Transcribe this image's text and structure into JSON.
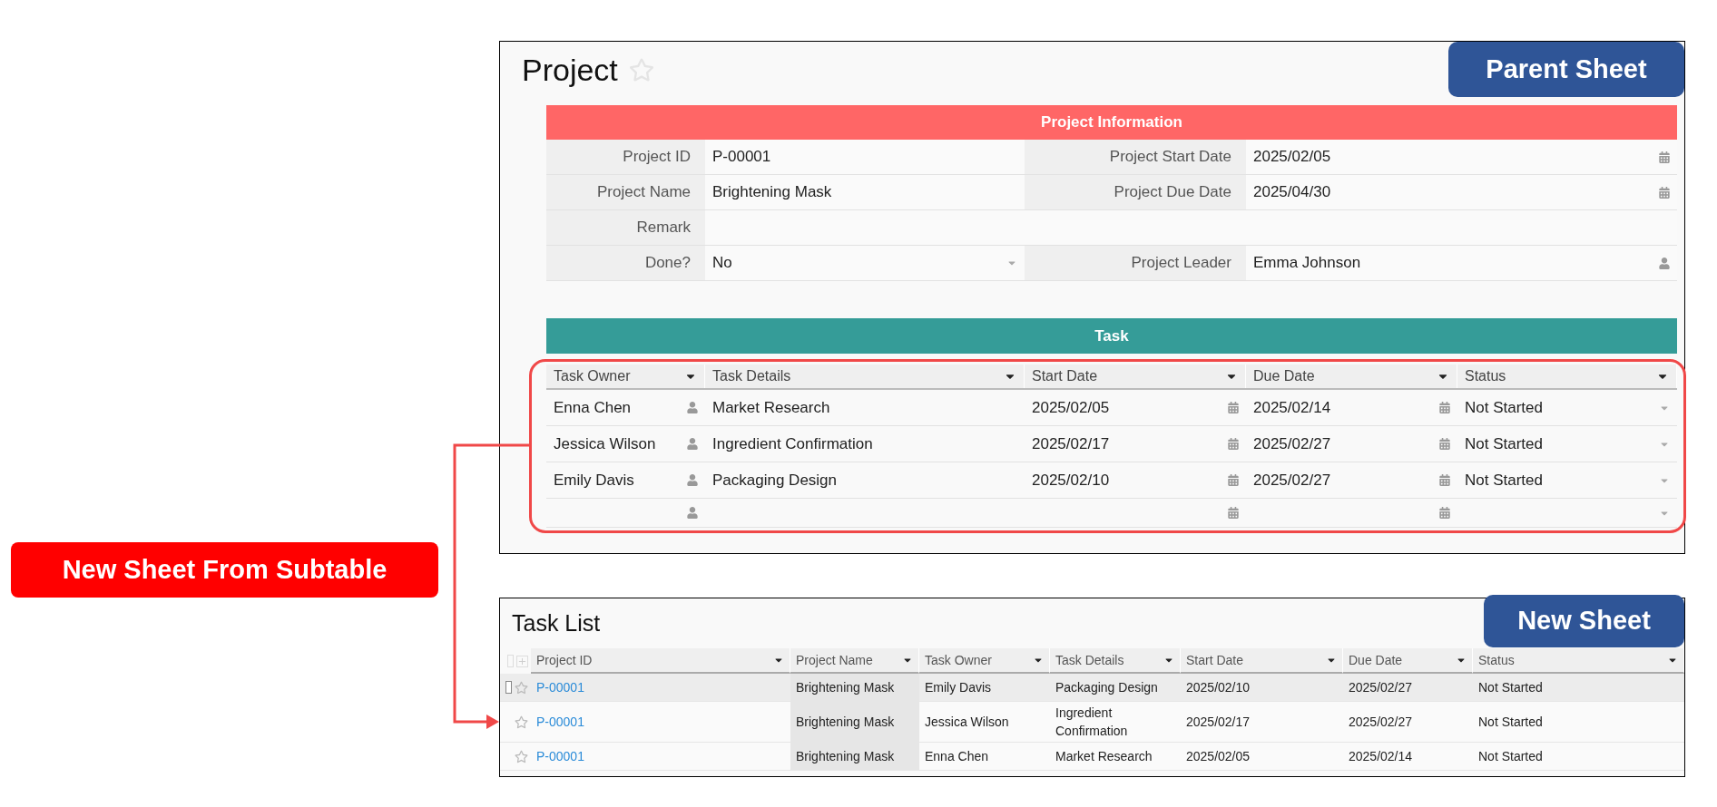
{
  "source_label": "New Sheet From Subtable",
  "parent_sheet": {
    "title": "Project",
    "favorite": false,
    "badge": "Parent Sheet",
    "section_title": "Project Information",
    "form_rows": [
      {
        "fields": [
          {
            "label": "Project ID",
            "value": "P-00001",
            "kind": "text"
          },
          {
            "label": "Project Start Date",
            "value": "2025/02/05",
            "kind": "date"
          }
        ]
      },
      {
        "fields": [
          {
            "label": "Project Name",
            "value": "Brightening Mask",
            "kind": "text"
          },
          {
            "label": "Project Due Date",
            "value": "2025/04/30",
            "kind": "date"
          }
        ]
      },
      {
        "fields": [
          {
            "label": "Remark",
            "kind": "text"
          }
        ]
      },
      {
        "fields": [
          {
            "label": "Done?",
            "value": "No",
            "kind": "select"
          },
          {
            "label": "Project Leader",
            "value": "Emma Johnson",
            "kind": "user"
          }
        ]
      }
    ],
    "subtable": {
      "title": "Task",
      "highlighted": true,
      "entry_row": true,
      "columns": [
        {
          "label": "Task Owner",
          "kind": "user"
        },
        {
          "label": "Task Details",
          "kind": "text"
        },
        {
          "label": "Start Date",
          "kind": "date"
        },
        {
          "label": "Due Date",
          "kind": "date"
        },
        {
          "label": "Status",
          "kind": "select"
        }
      ],
      "rows": [
        {
          "cells": [
            "Enna Chen",
            "Market Research",
            "2025/02/05",
            "2025/02/14",
            "Not Started"
          ]
        },
        {
          "cells": [
            "Jessica Wilson",
            "Ingredient Confirmation",
            "2025/02/17",
            "2025/02/27",
            "Not Started"
          ]
        },
        {
          "cells": [
            "Emily Davis",
            "Packaging Design",
            "2025/02/10",
            "2025/02/27",
            "Not Started"
          ]
        }
      ]
    }
  },
  "new_sheet": {
    "title": "Task List",
    "badge": "New Sheet",
    "select_all": false,
    "columns": [
      {
        "label": "Project ID",
        "shaded": false
      },
      {
        "label": "Project Name",
        "shaded": true
      },
      {
        "label": "Task Owner",
        "shaded": false
      },
      {
        "label": "Task Details",
        "shaded": false
      },
      {
        "label": "Start Date",
        "shaded": false
      },
      {
        "label": "Due Date",
        "shaded": false
      },
      {
        "label": "Status",
        "shaded": false
      }
    ],
    "rows": [
      {
        "selected": true,
        "favorite": false,
        "cells": [
          "P-00001",
          "Brightening Mask",
          "Emily Davis",
          "Packaging Design",
          "2025/02/10",
          "2025/02/27",
          "Not Started"
        ]
      },
      {
        "selected": false,
        "favorite": false,
        "cells": [
          "P-00001",
          "Brightening Mask",
          "Jessica Wilson",
          "Ingredient Confirmation",
          "2025/02/17",
          "2025/02/27",
          "Not Started"
        ]
      },
      {
        "selected": false,
        "favorite": false,
        "cells": [
          "P-00001",
          "Brightening Mask",
          "Enna Chen",
          "Market Research",
          "2025/02/05",
          "2025/02/14",
          "Not Started"
        ]
      }
    ]
  }
}
